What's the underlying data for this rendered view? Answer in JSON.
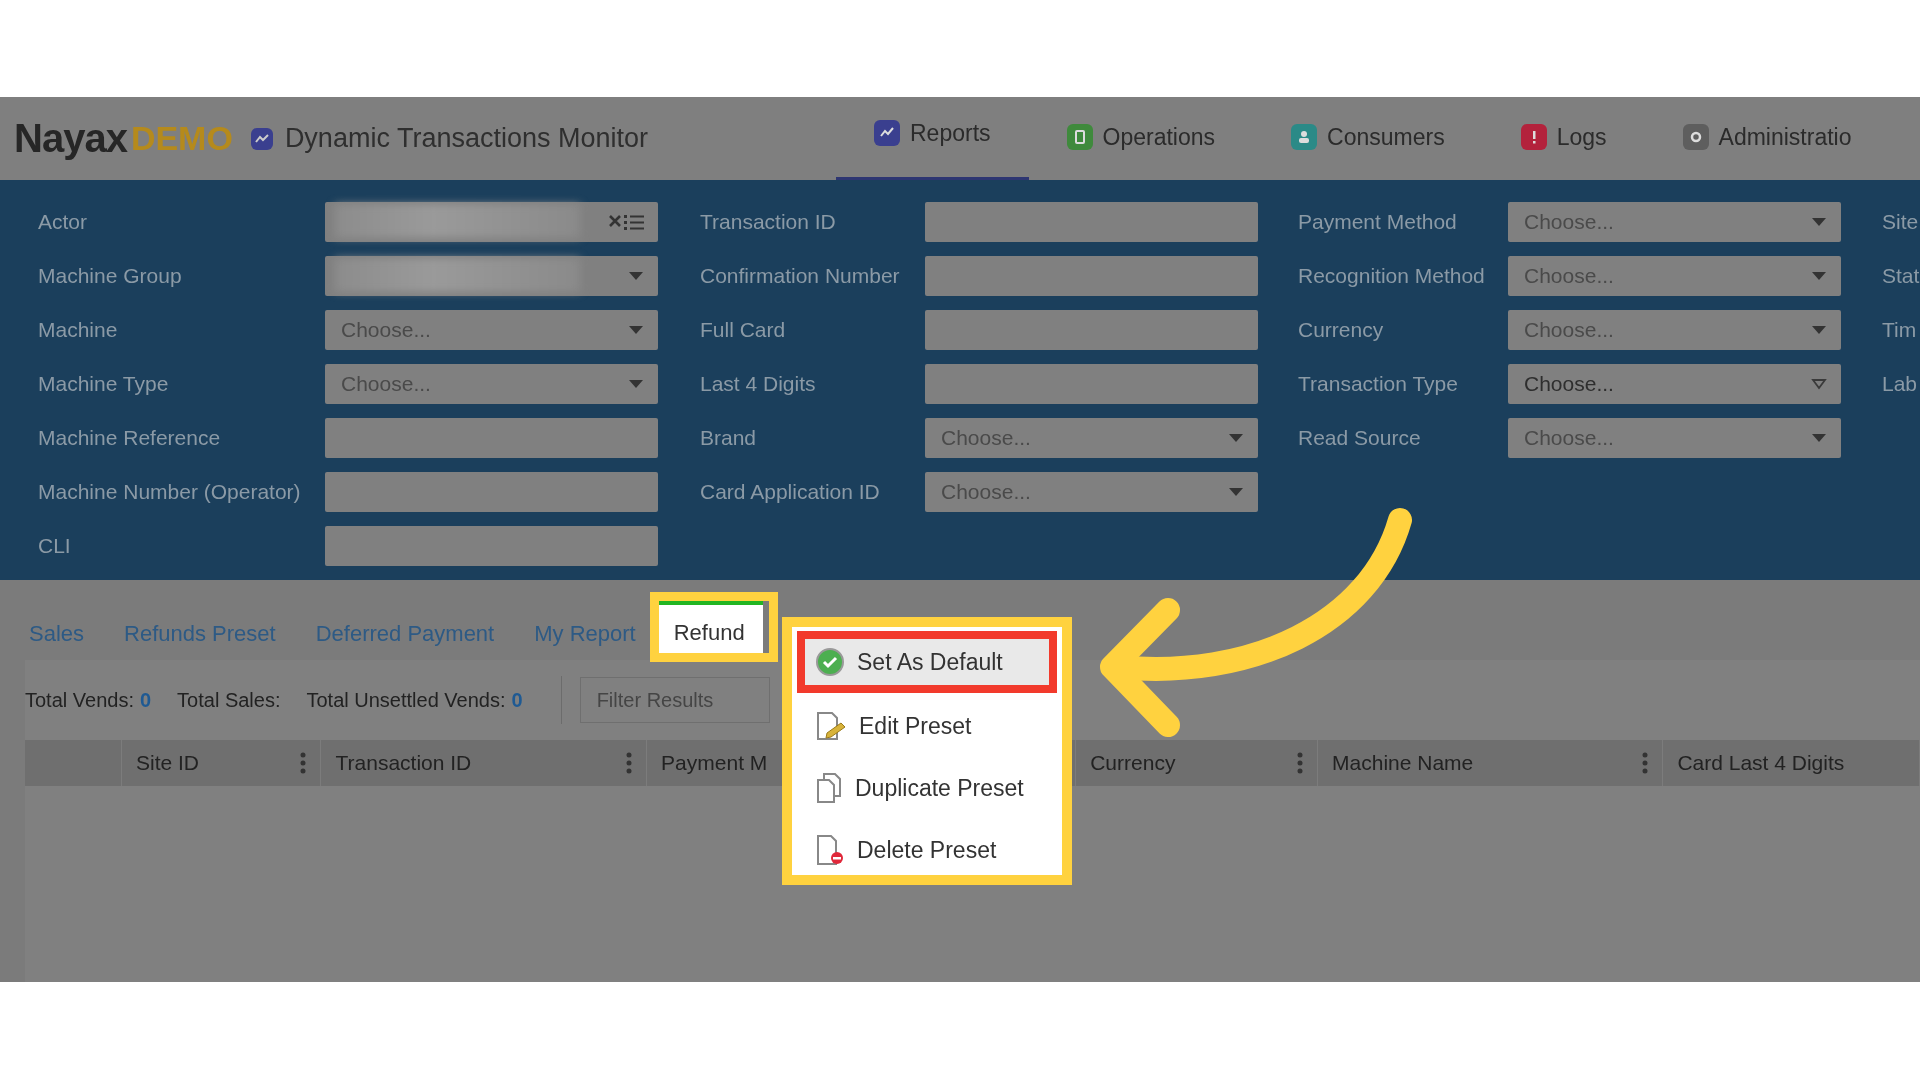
{
  "header": {
    "logo": {
      "brand": "Nayax",
      "suffix": "DEMO"
    },
    "title": "Dynamic Transactions Monitor",
    "nav": [
      {
        "label": "Reports",
        "selected": true,
        "color": "#3a3f8f"
      },
      {
        "label": "Operations",
        "selected": false,
        "color": "#3f8a3c"
      },
      {
        "label": "Consumers",
        "selected": false,
        "color": "#2b8a87"
      },
      {
        "label": "Logs",
        "selected": false,
        "color": "#b3223c"
      },
      {
        "label": "Administratio",
        "selected": false,
        "color": "#5e5e5e"
      }
    ]
  },
  "filters": {
    "columns": [
      {
        "fields": [
          {
            "label": "Actor",
            "kind": "redacted-picker"
          },
          {
            "label": "Machine Group",
            "kind": "redacted-select"
          },
          {
            "label": "Machine",
            "kind": "select",
            "placeholder": "Choose..."
          },
          {
            "label": "Machine Type",
            "kind": "select",
            "placeholder": "Choose..."
          },
          {
            "label": "Machine Reference",
            "kind": "text"
          },
          {
            "label": "Machine Number (Operator)",
            "kind": "text"
          },
          {
            "label": "CLI",
            "kind": "text"
          }
        ]
      },
      {
        "fields": [
          {
            "label": "Transaction ID",
            "kind": "text"
          },
          {
            "label": "Confirmation Number",
            "kind": "text"
          },
          {
            "label": "Full Card",
            "kind": "text"
          },
          {
            "label": "Last 4 Digits",
            "kind": "text"
          },
          {
            "label": "Brand",
            "kind": "select",
            "placeholder": "Choose..."
          },
          {
            "label": "Card Application ID",
            "kind": "select",
            "placeholder": "Choose..."
          }
        ]
      },
      {
        "fields": [
          {
            "label": "Payment Method",
            "kind": "select",
            "placeholder": "Choose..."
          },
          {
            "label": "Recognition Method",
            "kind": "select",
            "placeholder": "Choose..."
          },
          {
            "label": "Currency",
            "kind": "select",
            "placeholder": "Choose..."
          },
          {
            "label": "Transaction Type",
            "kind": "select",
            "value": "Choose..."
          },
          {
            "label": "Read Source",
            "kind": "select",
            "placeholder": "Choose..."
          }
        ]
      },
      {
        "fields": [
          {
            "label": "Site",
            "kind": "label"
          },
          {
            "label": "Stat",
            "kind": "label"
          },
          {
            "label": "Tim",
            "kind": "label"
          },
          {
            "label": "Lab",
            "kind": "label"
          }
        ]
      }
    ]
  },
  "report_tabs": [
    {
      "label": "Sales",
      "selected": false
    },
    {
      "label": "Refunds Preset",
      "selected": false
    },
    {
      "label": "Deferred Payment",
      "selected": false
    },
    {
      "label": "My Report",
      "selected": false
    },
    {
      "label": "Refund",
      "selected": true
    }
  ],
  "summary": [
    {
      "label": "Total Vends:",
      "value": "0"
    },
    {
      "label": "Total Sales:"
    },
    {
      "label": "Total Unsettled Vends:",
      "value": "0"
    }
  ],
  "filter_field": {
    "placeholder": "Filter Results"
  },
  "table": {
    "columns": [
      {
        "label": "Site ID",
        "menu": true
      },
      {
        "label": "Transaction ID",
        "menu": true
      },
      {
        "label": "Payment M",
        "menu": false
      },
      {
        "label": "Currency",
        "menu": true
      },
      {
        "label": "Machine Name",
        "menu": true
      },
      {
        "label": "Card Last 4 Digits",
        "menu": false
      }
    ]
  },
  "context_menu": {
    "items": [
      {
        "label": "Set As Default",
        "kind": "default",
        "selected": true
      },
      {
        "label": "Edit Preset",
        "kind": "edit",
        "selected": false
      },
      {
        "label": "Duplicate Preset",
        "kind": "duplicate",
        "selected": false
      },
      {
        "label": "Delete Preset",
        "kind": "delete",
        "selected": false
      }
    ]
  }
}
